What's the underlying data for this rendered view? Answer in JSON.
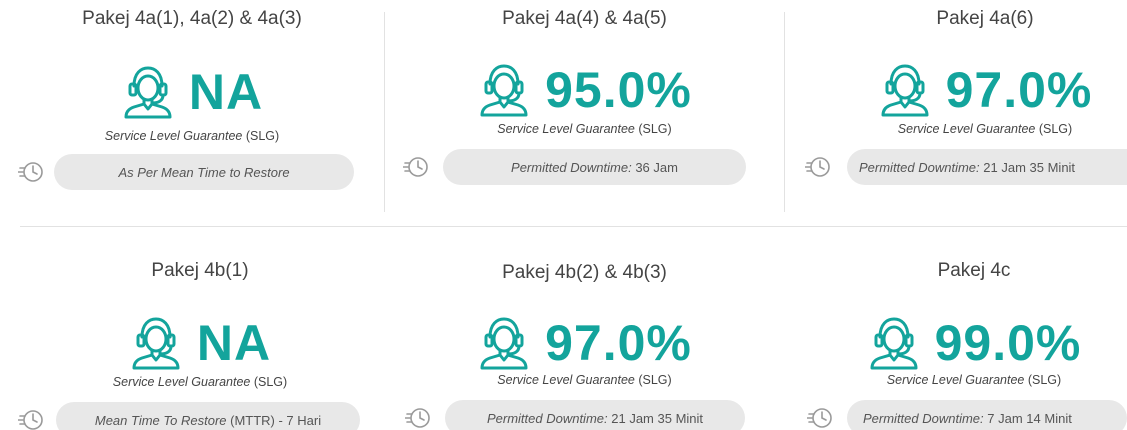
{
  "colors": {
    "accent": "#13a49c",
    "pill_bg": "#e8e8e8",
    "divider": "#e2e2e2",
    "text": "#444444"
  },
  "icons": {
    "metric_icon": "headset-agent-icon",
    "pill_icon": "fast-clock-icon"
  },
  "cards": [
    {
      "title": "Pakej 4a(1), 4a(2) & 4a(3)",
      "value": "NA",
      "slg_label": "Service Level Guarantee",
      "slg_abbr": "(SLG)",
      "pill_label": "As Per Mean Time to Restore",
      "pill_value": ""
    },
    {
      "title": "Pakej 4a(4) & 4a(5)",
      "value": "95.0%",
      "slg_label": "Service Level Guarantee",
      "slg_abbr": "(SLG)",
      "pill_label": "Permitted Downtime:",
      "pill_value": "36 Jam"
    },
    {
      "title": "Pakej 4a(6)",
      "value": "97.0%",
      "slg_label": "Service Level Guarantee",
      "slg_abbr": "(SLG)",
      "pill_label": "Permitted Downtime:",
      "pill_value": "21 Jam 35 Minit"
    },
    {
      "title": "Pakej 4b(1)",
      "value": "NA",
      "slg_label": "Service Level Guarantee",
      "slg_abbr": "(SLG)",
      "pill_label": "Mean Time To Restore",
      "pill_value": "(MTTR) - 7 Hari"
    },
    {
      "title": "Pakej 4b(2) & 4b(3)",
      "value": "97.0%",
      "slg_label": "Service Level Guarantee",
      "slg_abbr": "(SLG)",
      "pill_label": "Permitted Downtime:",
      "pill_value": "21 Jam 35 Minit"
    },
    {
      "title": "Pakej 4c",
      "value": "99.0%",
      "slg_label": "Service Level Guarantee",
      "slg_abbr": "(SLG)",
      "pill_label": "Permitted Downtime:",
      "pill_value": "7 Jam 14 Minit"
    }
  ]
}
